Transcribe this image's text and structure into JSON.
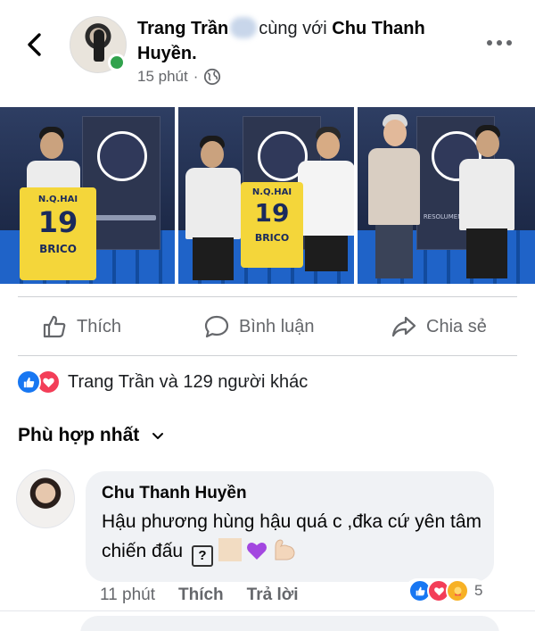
{
  "post": {
    "author": "Trang Trần",
    "with_text": "cùng với",
    "tagged": "Chu Thanh Huyền.",
    "time": "15 phút",
    "separator": "·"
  },
  "photos": [
    {
      "shirt_name": "N.Q.HAI",
      "shirt_number": "19",
      "sponsor": "BRICO"
    },
    {
      "shirt_name": "N.Q.HAI",
      "shirt_number": "19",
      "sponsor": "BRICO"
    },
    {
      "caption": "RESOLUMENT PALOIS"
    }
  ],
  "actions": {
    "like": "Thích",
    "comment": "Bình luận",
    "share": "Chia sẻ"
  },
  "reactions": {
    "summary": "Trang Trần và 129 người khác",
    "types": [
      "like",
      "love"
    ]
  },
  "sort": {
    "label": "Phù hợp nhất"
  },
  "comment": {
    "author": "Chu Thanh Huyền",
    "text": "Hậu phương hùng hậu quá c ,đka cứ yên tâm chiến đấu",
    "emoji_q": "?",
    "time": "11 phút",
    "like": "Thích",
    "reply": "Trả lời",
    "reaction_count": "5",
    "reaction_types": [
      "like",
      "love",
      "care"
    ]
  },
  "colors": {
    "like_blue": "#1877f2",
    "love_red": "#f33e58",
    "care_yellow": "#f7b125",
    "online_green": "#31a24c",
    "secondary_text": "#65676b"
  }
}
